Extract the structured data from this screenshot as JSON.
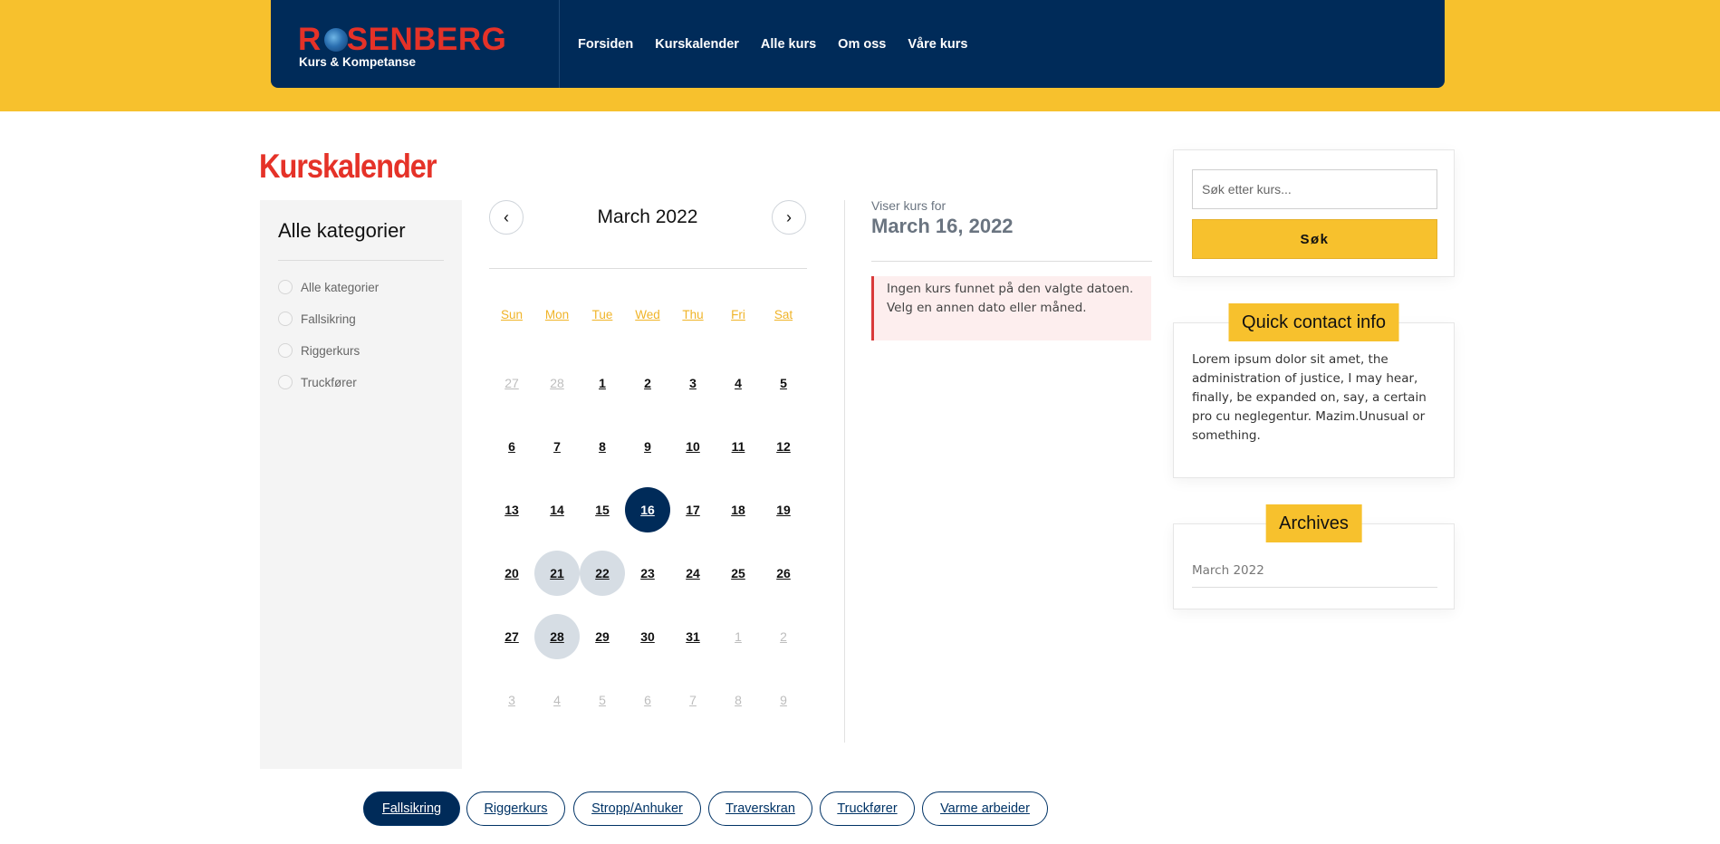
{
  "header": {
    "logo_main": "RSENBERG",
    "logo_letter_r": "R",
    "logo_sub": "Kurs & Kompetanse",
    "nav": [
      "Forsiden",
      "Kurskalender",
      "Alle kurs",
      "Om oss",
      "Våre kurs"
    ]
  },
  "page": {
    "title": "Kurskalender"
  },
  "categories": {
    "title": "Alle kategorier",
    "items": [
      "Alle kategorier",
      "Fallsikring",
      "Riggerkurs",
      "Truckfører"
    ]
  },
  "calendar": {
    "month_label": "March 2022",
    "prev_icon": "‹",
    "next_icon": "›",
    "weekdays": [
      "Sun",
      "Mon",
      "Tue",
      "Wed",
      "Thu",
      "Fri",
      "Sat"
    ],
    "weeks": [
      [
        "27",
        "28",
        "1",
        "2",
        "3",
        "4",
        "5"
      ],
      [
        "6",
        "7",
        "8",
        "9",
        "10",
        "11",
        "12"
      ],
      [
        "13",
        "14",
        "15",
        "16",
        "17",
        "18",
        "19"
      ],
      [
        "20",
        "21",
        "22",
        "23",
        "24",
        "25",
        "26"
      ],
      [
        "27",
        "28",
        "29",
        "30",
        "31",
        "1",
        "2"
      ],
      [
        "3",
        "4",
        "5",
        "6",
        "7",
        "8",
        "9"
      ]
    ],
    "selected": "16",
    "highlighted": [
      "21",
      "22",
      "28"
    ]
  },
  "showing": {
    "label": "Viser kurs for",
    "date": "March 16, 2022",
    "alert": "Ingen kurs funnet på den valgte datoen. Velg en annen dato eller måned."
  },
  "sidebar": {
    "search_placeholder": "Søk etter kurs...",
    "search_button": "Søk",
    "contact_title": "Quick contact info",
    "contact_text": "Lorem ipsum dolor sit amet, the administration of justice, I may hear, finally, be expanded on, say, a certain pro cu neglegentur. Mazim.Unusual or something.",
    "archives_title": "Archives",
    "archive_item": "March 2022"
  },
  "course_tags": [
    "Fallsikring",
    "Riggerkurs",
    "Stropp/Anhuker",
    "Traverskran",
    "Truckfører",
    "Varme arbeider"
  ],
  "colors": {
    "navy": "#002b59",
    "yellow": "#f7c12d",
    "red": "#e53228"
  }
}
